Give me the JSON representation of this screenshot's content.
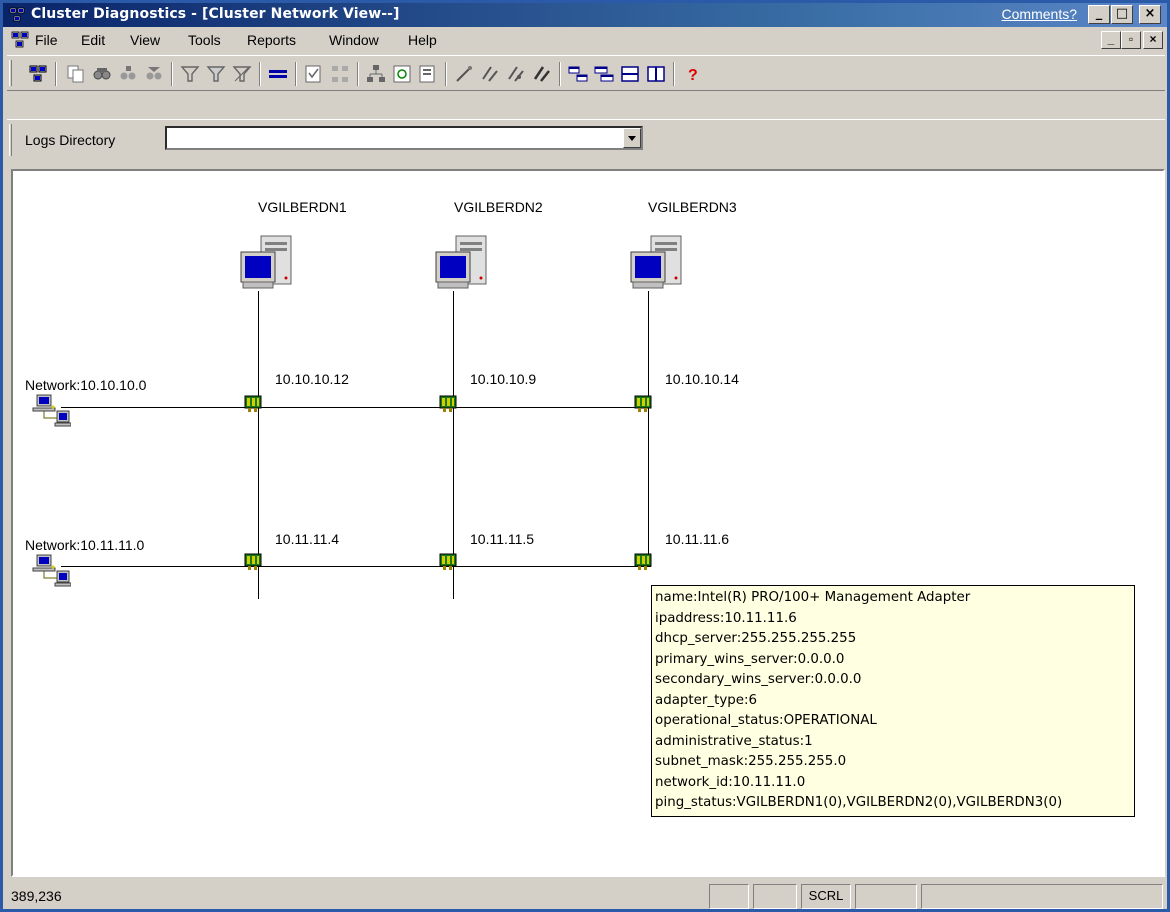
{
  "window": {
    "title": "Cluster Diagnostics - [Cluster Network View--]",
    "comments_link": "Comments?"
  },
  "menu": [
    "File",
    "Edit",
    "View",
    "Tools",
    "Reports",
    "Window",
    "Help"
  ],
  "logs": {
    "label": "Logs Directory",
    "value": ""
  },
  "nodes": [
    {
      "name": "VGILBERDN1"
    },
    {
      "name": "VGILBERDN2"
    },
    {
      "name": "VGILBERDN3"
    }
  ],
  "networks": [
    {
      "label": "Network:10.10.10.0",
      "adapters": [
        "10.10.10.12",
        "10.10.10.9",
        "10.10.10.14"
      ]
    },
    {
      "label": "Network:10.11.11.0",
      "adapters": [
        "10.11.11.4",
        "10.11.11.5",
        "10.11.11.6"
      ]
    }
  ],
  "tooltip": {
    "lines": [
      "name:Intel(R) PRO/100+ Management Adapter",
      "ipaddress:10.11.11.6",
      "dhcp_server:255.255.255.255",
      "primary_wins_server:0.0.0.0",
      "secondary_wins_server:0.0.0.0",
      "adapter_type:6",
      "operational_status:OPERATIONAL",
      "administrative_status:1",
      "subnet_mask:255.255.255.0",
      "network_id:10.11.11.0",
      "ping_status:VGILBERDN1(0),VGILBERDN2(0),VGILBERDN3(0)"
    ]
  },
  "status": {
    "coordinates": "389,236",
    "scrl": "SCRL"
  },
  "toolbar_icons": [
    "app-icon",
    "copy-icon",
    "find-icon",
    "find-node-icon",
    "find-resource-icon",
    "filter-icon",
    "filter-edit-icon",
    "filter-clear-icon",
    "separator-view-icon",
    "report-icon",
    "network-icon",
    "cluster-icon",
    "refresh-icon",
    "document-icon",
    "wand-icon",
    "tool-a-icon",
    "tool-b-icon",
    "tool-c-icon",
    "tile-a-icon",
    "tile-b-icon",
    "split-horizontal-icon",
    "split-vertical-icon",
    "help-icon"
  ]
}
